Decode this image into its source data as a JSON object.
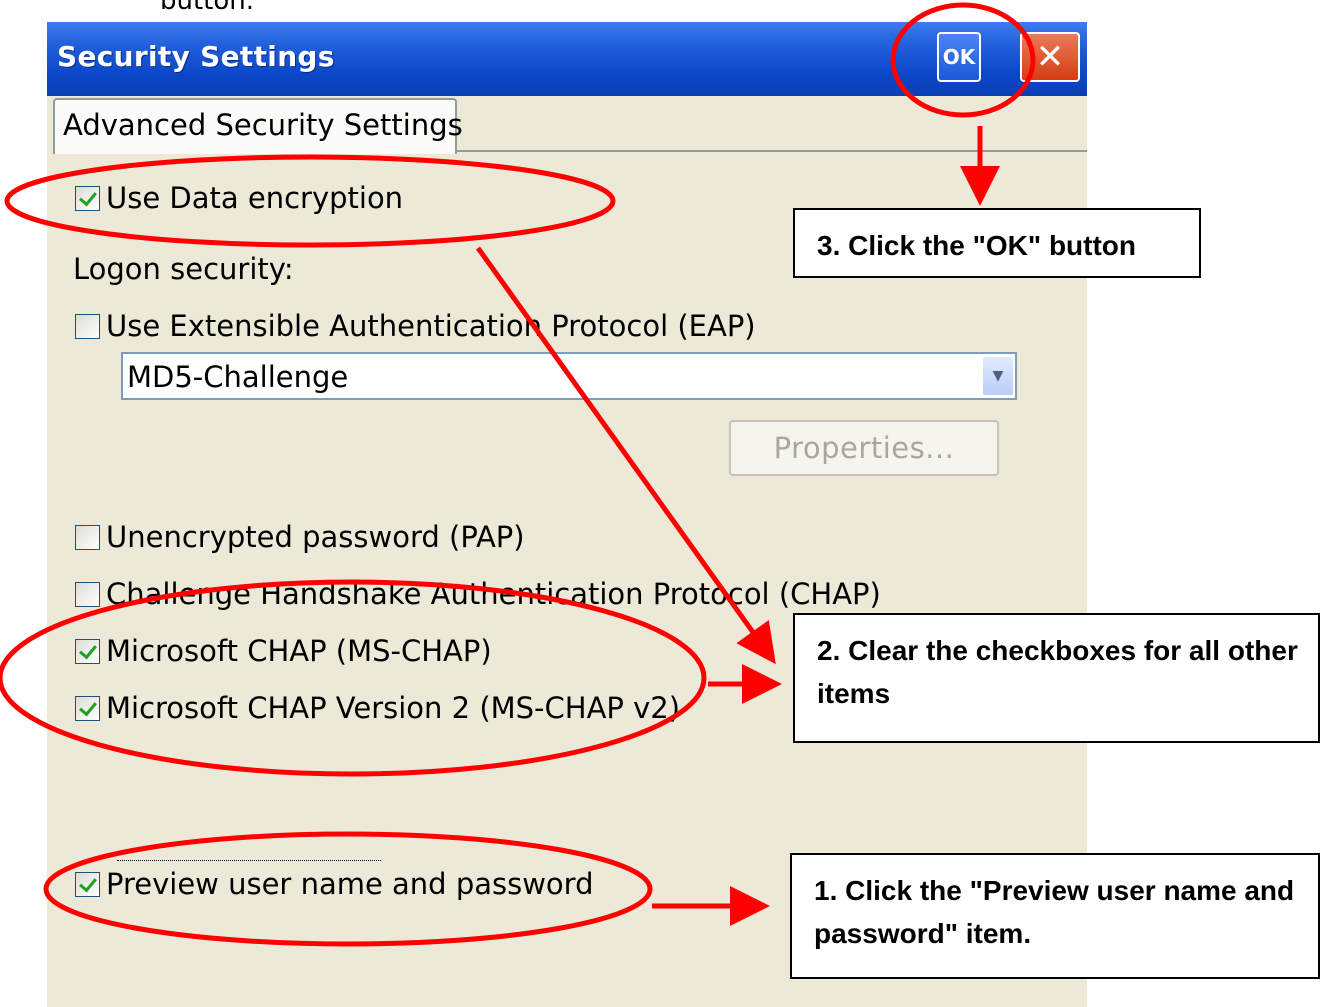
{
  "top_fragment": "button.",
  "window": {
    "title": "Security Settings",
    "ok_label": "OK",
    "close_glyph": "✕",
    "tab_label": "Advanced Security Settings"
  },
  "settings": {
    "use_data_encryption": {
      "label": "Use Data encryption",
      "checked": true
    },
    "logon_security_label": "Logon security:",
    "eap": {
      "label": "Use Extensible Authentication Protocol (EAP)",
      "checked": false
    },
    "eap_method": {
      "value": "MD5-Challenge"
    },
    "properties_label": "Properties...",
    "pap": {
      "label": "Unencrypted password (PAP)",
      "checked": false
    },
    "chap": {
      "label": "Challenge Handshake Authentication Protocol (CHAP)",
      "checked": false
    },
    "ms_chap": {
      "label": "Microsoft CHAP (MS-CHAP)",
      "checked": true
    },
    "ms_chap_v2": {
      "label": "Microsoft CHAP Version 2 (MS-CHAP v2)",
      "checked": true
    },
    "preview": {
      "label": "Preview user name and password",
      "checked": true
    }
  },
  "callouts": {
    "step1": "1. Click the \"Preview user name and password\" item.",
    "step2": "2. Clear the checkboxes for all other items",
    "step3": "3. Click the \"OK\" button"
  },
  "colors": {
    "annotation": "#ff0000",
    "titlebar": "#0b47c8",
    "dialog_bg": "#ece9d8"
  },
  "icons": [
    "checkbox-icon",
    "dropdown-arrow-icon",
    "close-icon"
  ]
}
